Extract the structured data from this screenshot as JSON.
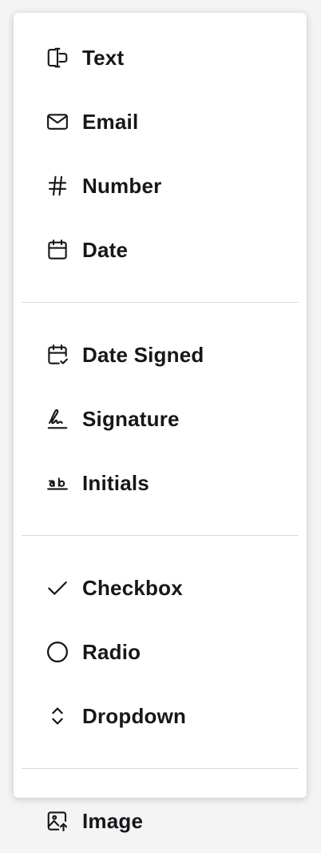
{
  "menu": {
    "groups": [
      {
        "items": [
          {
            "label": "Text",
            "icon": "text-cursor-icon"
          },
          {
            "label": "Email",
            "icon": "mail-icon"
          },
          {
            "label": "Number",
            "icon": "hash-icon"
          },
          {
            "label": "Date",
            "icon": "calendar-icon"
          }
        ]
      },
      {
        "items": [
          {
            "label": "Date Signed",
            "icon": "calendar-check-icon"
          },
          {
            "label": "Signature",
            "icon": "signature-icon"
          },
          {
            "label": "Initials",
            "icon": "initials-icon"
          }
        ]
      },
      {
        "items": [
          {
            "label": "Checkbox",
            "icon": "check-icon"
          },
          {
            "label": "Radio",
            "icon": "circle-icon"
          },
          {
            "label": "Dropdown",
            "icon": "chevrons-up-down-icon"
          }
        ]
      },
      {
        "items": [
          {
            "label": "Image",
            "icon": "image-upload-icon"
          }
        ]
      }
    ]
  }
}
